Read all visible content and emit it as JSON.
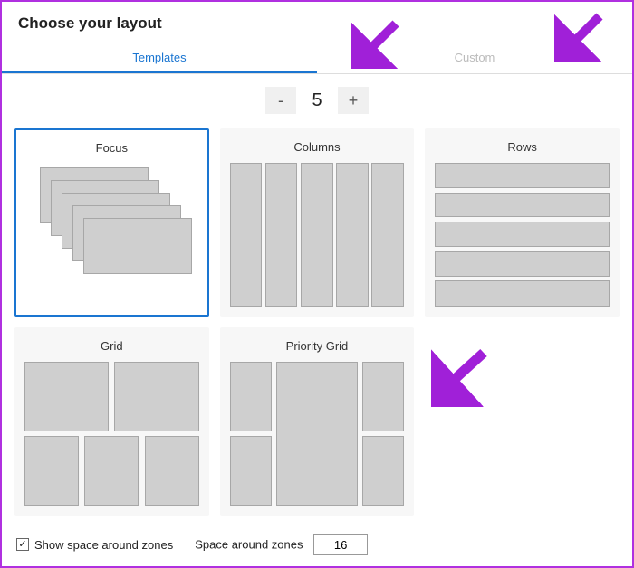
{
  "title": "Choose your layout",
  "tabs": {
    "templates": "Templates",
    "custom": "Custom",
    "active": "templates"
  },
  "stepper": {
    "minus": "-",
    "value": "5",
    "plus": "+"
  },
  "layouts": {
    "focus": "Focus",
    "columns": "Columns",
    "rows": "Rows",
    "grid": "Grid",
    "priority_grid": "Priority Grid",
    "selected": "focus"
  },
  "footer": {
    "show_space_label": "Show space around zones",
    "show_space_checked": true,
    "space_label": "Space around zones",
    "space_value": "16"
  },
  "annotations": {
    "arrow_color": "#a020d8"
  }
}
